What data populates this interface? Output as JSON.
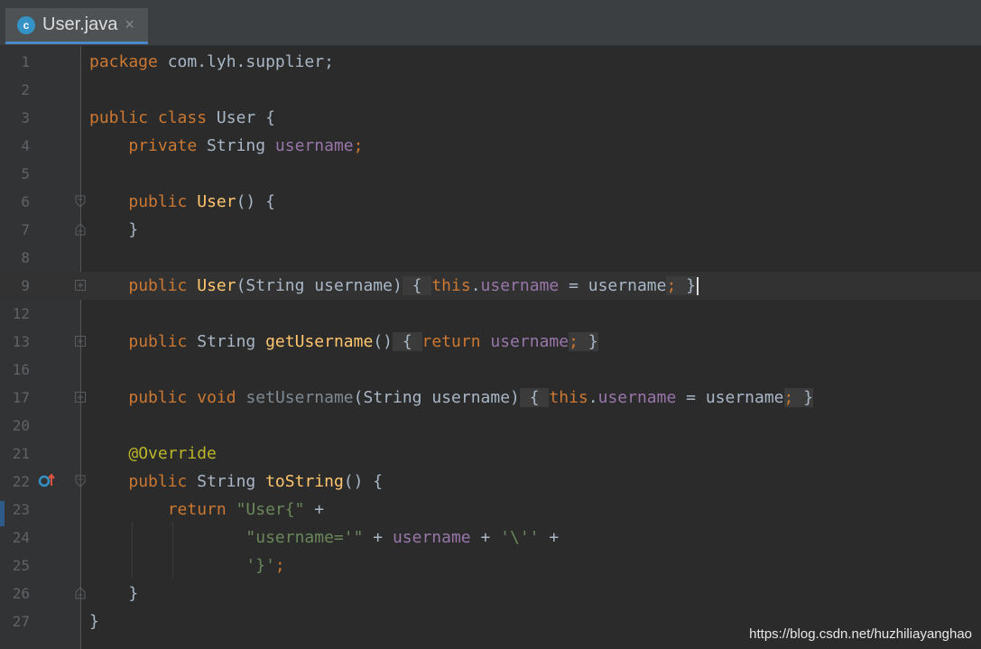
{
  "tab": {
    "filename": "User.java",
    "icon": "java-class-icon",
    "icon_letter": "c",
    "close_glyph": "×"
  },
  "colors": {
    "keyword": "#cc7832",
    "function": "#ffc66d",
    "field": "#9876aa",
    "string": "#6a8759",
    "annotation": "#bbb529",
    "text": "#a9b7c6"
  },
  "lines": [
    {
      "num": "1"
    },
    {
      "num": "2"
    },
    {
      "num": "3"
    },
    {
      "num": "4"
    },
    {
      "num": "5"
    },
    {
      "num": "6"
    },
    {
      "num": "7"
    },
    {
      "num": "8"
    },
    {
      "num": "9"
    },
    {
      "num": "12"
    },
    {
      "num": "13"
    },
    {
      "num": "16"
    },
    {
      "num": "17"
    },
    {
      "num": "20"
    },
    {
      "num": "21"
    },
    {
      "num": "22"
    },
    {
      "num": "23"
    },
    {
      "num": "24"
    },
    {
      "num": "25"
    },
    {
      "num": "26"
    },
    {
      "num": "27"
    }
  ],
  "code": {
    "l1": {
      "kw": "package",
      "rest": " com.lyh.supplier;"
    },
    "l3": {
      "kw1": "public",
      "kw2": "class",
      "rest": " User {"
    },
    "l4": {
      "kw": "private",
      "type": " String ",
      "field": "username",
      "end": ";"
    },
    "l6": {
      "kw": "public",
      "fn": "User",
      "rest": "() {"
    },
    "l7": {
      "text": "}"
    },
    "l9": {
      "kw": "public",
      "fn": "User",
      "params": "(String username)",
      "ob": " { ",
      "kw2": "this",
      "dot": ".",
      "field": "username",
      "eq": " = username",
      "semi": "; ",
      "cb": "}"
    },
    "l13": {
      "kw": "public",
      "type": " String ",
      "fn": "getUsername",
      "params": "()",
      "ob": " { ",
      "kw2": "return",
      "field": " username",
      "semi": "; ",
      "cb": "}"
    },
    "l17": {
      "kw": "public",
      "kw2": "void",
      "fn": "setUsername",
      "params": "(String username)",
      "ob": " { ",
      "kw3": "this",
      "dot": ".",
      "field": "username",
      "eq": " = username",
      "semi": "; ",
      "cb": "}"
    },
    "l21": {
      "ann": "@Override"
    },
    "l22": {
      "kw": "public",
      "type": " String ",
      "fn": "toString",
      "rest": "() {"
    },
    "l23": {
      "kw": "return",
      "str": "\"User{\"",
      "rest": " +"
    },
    "l24": {
      "str1": "\"username='\"",
      "plus1": " + ",
      "field": "username",
      "plus2": " + ",
      "str2": "'\\''",
      "plus3": " +"
    },
    "l25": {
      "str": "'}'",
      "semi": ";"
    },
    "l26": {
      "text": "}"
    },
    "l27": {
      "text": "}"
    }
  },
  "watermark": "https://blog.csdn.net/huzhiliayanghao"
}
